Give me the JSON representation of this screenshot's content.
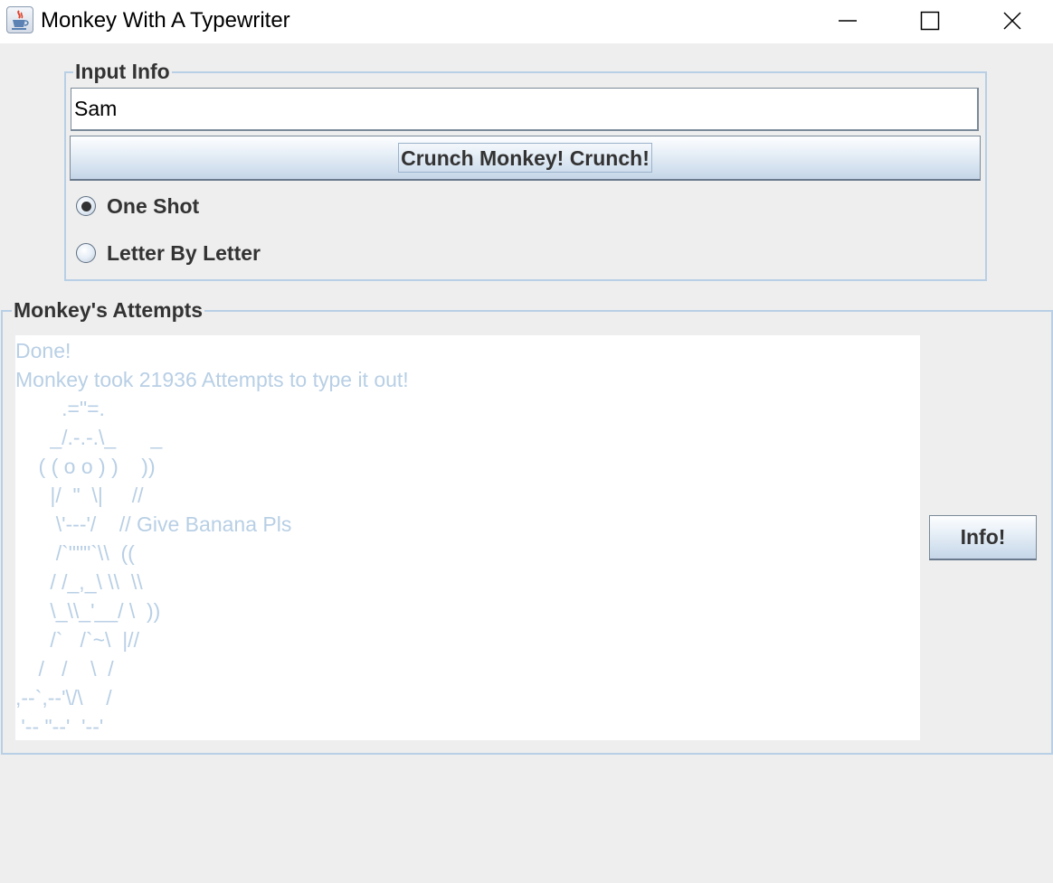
{
  "window": {
    "title": "Monkey With A Typewriter",
    "icon": "java-cup-icon"
  },
  "input_info": {
    "legend": "Input Info",
    "name_value": "Sam",
    "crunch_button": "Crunch Monkey! Crunch!",
    "options": [
      {
        "label": "One Shot",
        "selected": true
      },
      {
        "label": "Letter By Letter",
        "selected": false
      }
    ]
  },
  "attempts": {
    "legend": "Monkey's Attempts",
    "lines": [
      "Done!",
      "Monkey took 21936 Attempts to type it out!",
      "        .=\"=.",
      "      _/.-.-.\\_      _",
      "    ( ( o o ) )    ))",
      "      |/  \"  \\|     //",
      "       \\'---'/    // Give Banana Pls",
      "       /`\"\"\"`\\\\  ((",
      "      / /_,_\\ \\\\  \\\\",
      "      \\_\\\\_'__/ \\  ))",
      "      /`   /`~\\  |//",
      "    /   /    \\  /",
      ",--`,--'\\/\\    /",
      " '-- \"--'  '--'"
    ],
    "info_button": "Info!"
  },
  "colors": {
    "border": "#b8cfe5",
    "output_text": "#b8cfe5",
    "background": "#eeeeee"
  }
}
